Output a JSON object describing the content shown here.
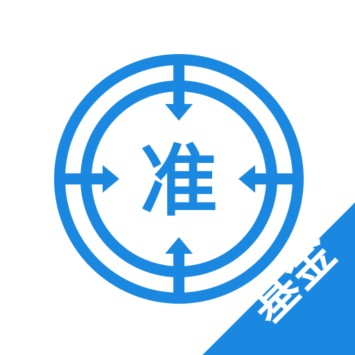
{
  "icon": {
    "center_text": "准",
    "badge_text": "基金",
    "colors": {
      "primary": "#1a88e0",
      "background": "#ffffff",
      "badge_text": "#ffffff"
    },
    "symbol": "crosshair-target-icon"
  }
}
